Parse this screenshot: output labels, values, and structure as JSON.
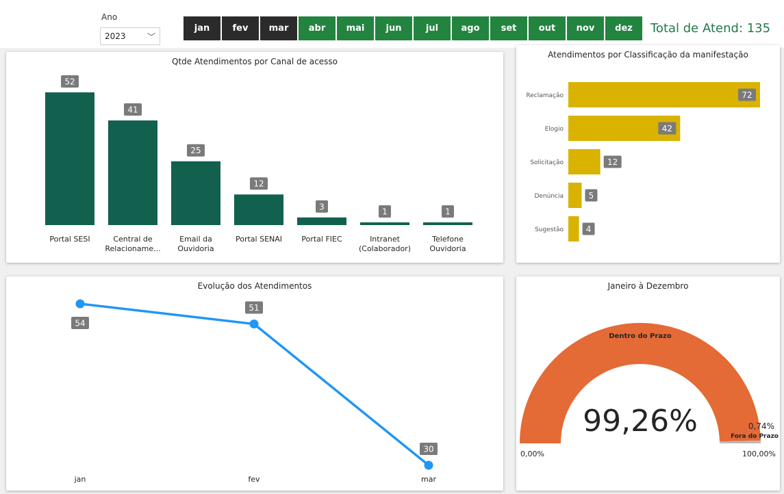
{
  "filters": {
    "year_label": "Ano",
    "year_value": "2023",
    "months": [
      {
        "label": "jan",
        "selected": true
      },
      {
        "label": "fev",
        "selected": true
      },
      {
        "label": "mar",
        "selected": true
      },
      {
        "label": "abr",
        "selected": false
      },
      {
        "label": "mai",
        "selected": false
      },
      {
        "label": "jun",
        "selected": false
      },
      {
        "label": "jul",
        "selected": false
      },
      {
        "label": "ago",
        "selected": false
      },
      {
        "label": "set",
        "selected": false
      },
      {
        "label": "out",
        "selected": false
      },
      {
        "label": "nov",
        "selected": false
      },
      {
        "label": "dez",
        "selected": false
      }
    ],
    "selected_color": "#2b2b2b",
    "unselected_color": "#22843f"
  },
  "total": {
    "label": "Total de Atend: 135"
  },
  "colors": {
    "bar_green": "#12614f",
    "bar_gold": "#d9b300",
    "line_blue": "#2196f3",
    "gauge_orange": "#e46a36",
    "label_badge": "#7a7a7a"
  },
  "chart_data": [
    {
      "type": "bar",
      "title": "Qtde Atendimentos por Canal de acesso",
      "categories": [
        [
          "Portal SESI"
        ],
        [
          "Central de",
          "Relacioname..."
        ],
        [
          "Email da",
          "Ouvidoria"
        ],
        [
          "Portal SENAI"
        ],
        [
          "Portal FIEC"
        ],
        [
          "Intranet",
          "(Colaborador)"
        ],
        [
          "Telefone",
          "Ouvidoria"
        ]
      ],
      "values": [
        52,
        41,
        25,
        12,
        3,
        1,
        1
      ],
      "ylim": [
        0,
        52
      ]
    },
    {
      "type": "bar",
      "orientation": "horizontal",
      "title": "Atendimentos por Classificação da manifestação",
      "categories": [
        "Reclamação",
        "Elogio",
        "Solicitação",
        "Denúncia",
        "Sugestão"
      ],
      "values": [
        72,
        42,
        12,
        5,
        4
      ],
      "xlim": [
        0,
        72
      ]
    },
    {
      "type": "line",
      "title": "Evolução dos Atendimentos",
      "x": [
        "jan",
        "fev",
        "mar"
      ],
      "values": [
        54,
        51,
        30
      ]
    },
    {
      "type": "gauge",
      "title": "Janeiro à Dezembro",
      "value_label": "99,26%",
      "value": 99.26,
      "remainder_label": "0,74%",
      "segment_in": "Dentro do Prazo",
      "segment_out": "Fora do Prazo",
      "min_label": "0,00%",
      "max_label": "100,00%"
    }
  ]
}
